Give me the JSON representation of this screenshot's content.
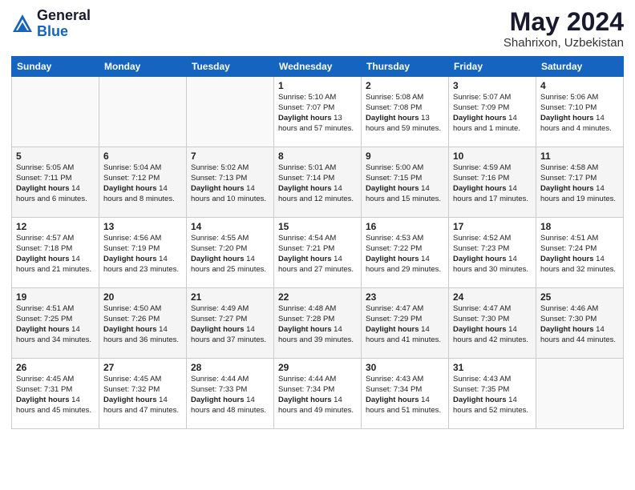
{
  "header": {
    "logo_general": "General",
    "logo_blue": "Blue",
    "month": "May 2024",
    "location": "Shahrixon, Uzbekistan"
  },
  "weekdays": [
    "Sunday",
    "Monday",
    "Tuesday",
    "Wednesday",
    "Thursday",
    "Friday",
    "Saturday"
  ],
  "weeks": [
    [
      {
        "day": "",
        "info": ""
      },
      {
        "day": "",
        "info": ""
      },
      {
        "day": "",
        "info": ""
      },
      {
        "day": "1",
        "info": "Sunrise: 5:10 AM\nSunset: 7:07 PM\nDaylight: 13 hours and 57 minutes."
      },
      {
        "day": "2",
        "info": "Sunrise: 5:08 AM\nSunset: 7:08 PM\nDaylight: 13 hours and 59 minutes."
      },
      {
        "day": "3",
        "info": "Sunrise: 5:07 AM\nSunset: 7:09 PM\nDaylight: 14 hours and 1 minute."
      },
      {
        "day": "4",
        "info": "Sunrise: 5:06 AM\nSunset: 7:10 PM\nDaylight: 14 hours and 4 minutes."
      }
    ],
    [
      {
        "day": "5",
        "info": "Sunrise: 5:05 AM\nSunset: 7:11 PM\nDaylight: 14 hours and 6 minutes."
      },
      {
        "day": "6",
        "info": "Sunrise: 5:04 AM\nSunset: 7:12 PM\nDaylight: 14 hours and 8 minutes."
      },
      {
        "day": "7",
        "info": "Sunrise: 5:02 AM\nSunset: 7:13 PM\nDaylight: 14 hours and 10 minutes."
      },
      {
        "day": "8",
        "info": "Sunrise: 5:01 AM\nSunset: 7:14 PM\nDaylight: 14 hours and 12 minutes."
      },
      {
        "day": "9",
        "info": "Sunrise: 5:00 AM\nSunset: 7:15 PM\nDaylight: 14 hours and 15 minutes."
      },
      {
        "day": "10",
        "info": "Sunrise: 4:59 AM\nSunset: 7:16 PM\nDaylight: 14 hours and 17 minutes."
      },
      {
        "day": "11",
        "info": "Sunrise: 4:58 AM\nSunset: 7:17 PM\nDaylight: 14 hours and 19 minutes."
      }
    ],
    [
      {
        "day": "12",
        "info": "Sunrise: 4:57 AM\nSunset: 7:18 PM\nDaylight: 14 hours and 21 minutes."
      },
      {
        "day": "13",
        "info": "Sunrise: 4:56 AM\nSunset: 7:19 PM\nDaylight: 14 hours and 23 minutes."
      },
      {
        "day": "14",
        "info": "Sunrise: 4:55 AM\nSunset: 7:20 PM\nDaylight: 14 hours and 25 minutes."
      },
      {
        "day": "15",
        "info": "Sunrise: 4:54 AM\nSunset: 7:21 PM\nDaylight: 14 hours and 27 minutes."
      },
      {
        "day": "16",
        "info": "Sunrise: 4:53 AM\nSunset: 7:22 PM\nDaylight: 14 hours and 29 minutes."
      },
      {
        "day": "17",
        "info": "Sunrise: 4:52 AM\nSunset: 7:23 PM\nDaylight: 14 hours and 30 minutes."
      },
      {
        "day": "18",
        "info": "Sunrise: 4:51 AM\nSunset: 7:24 PM\nDaylight: 14 hours and 32 minutes."
      }
    ],
    [
      {
        "day": "19",
        "info": "Sunrise: 4:51 AM\nSunset: 7:25 PM\nDaylight: 14 hours and 34 minutes."
      },
      {
        "day": "20",
        "info": "Sunrise: 4:50 AM\nSunset: 7:26 PM\nDaylight: 14 hours and 36 minutes."
      },
      {
        "day": "21",
        "info": "Sunrise: 4:49 AM\nSunset: 7:27 PM\nDaylight: 14 hours and 37 minutes."
      },
      {
        "day": "22",
        "info": "Sunrise: 4:48 AM\nSunset: 7:28 PM\nDaylight: 14 hours and 39 minutes."
      },
      {
        "day": "23",
        "info": "Sunrise: 4:47 AM\nSunset: 7:29 PM\nDaylight: 14 hours and 41 minutes."
      },
      {
        "day": "24",
        "info": "Sunrise: 4:47 AM\nSunset: 7:30 PM\nDaylight: 14 hours and 42 minutes."
      },
      {
        "day": "25",
        "info": "Sunrise: 4:46 AM\nSunset: 7:30 PM\nDaylight: 14 hours and 44 minutes."
      }
    ],
    [
      {
        "day": "26",
        "info": "Sunrise: 4:45 AM\nSunset: 7:31 PM\nDaylight: 14 hours and 45 minutes."
      },
      {
        "day": "27",
        "info": "Sunrise: 4:45 AM\nSunset: 7:32 PM\nDaylight: 14 hours and 47 minutes."
      },
      {
        "day": "28",
        "info": "Sunrise: 4:44 AM\nSunset: 7:33 PM\nDaylight: 14 hours and 48 minutes."
      },
      {
        "day": "29",
        "info": "Sunrise: 4:44 AM\nSunset: 7:34 PM\nDaylight: 14 hours and 49 minutes."
      },
      {
        "day": "30",
        "info": "Sunrise: 4:43 AM\nSunset: 7:34 PM\nDaylight: 14 hours and 51 minutes."
      },
      {
        "day": "31",
        "info": "Sunrise: 4:43 AM\nSunset: 7:35 PM\nDaylight: 14 hours and 52 minutes."
      },
      {
        "day": "",
        "info": ""
      }
    ]
  ]
}
